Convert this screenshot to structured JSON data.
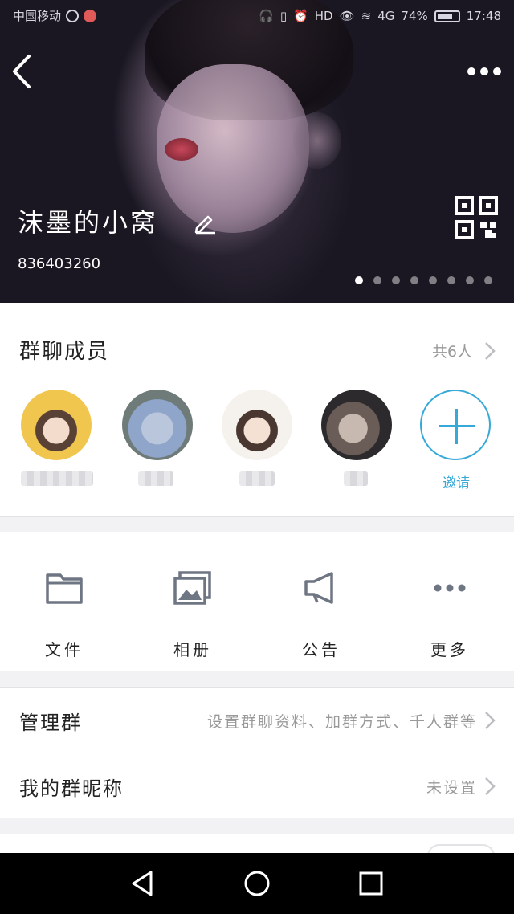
{
  "status_bar": {
    "carrier": "中国移动",
    "network": "4G",
    "battery": "74%",
    "battery_level": 0.74,
    "time": "17:48"
  },
  "header": {
    "group_name": "沫墨的小窝",
    "group_id": "836403260",
    "page_count": 8,
    "page_active": 1
  },
  "members": {
    "title": "群聊成员",
    "count": "共6人",
    "invite_label": "邀请"
  },
  "features": [
    {
      "label": "文件",
      "icon": "folder-icon"
    },
    {
      "label": "相册",
      "icon": "album-icon"
    },
    {
      "label": "公告",
      "icon": "megaphone-icon"
    },
    {
      "label": "更多",
      "icon": "more-dots-icon"
    }
  ],
  "rows": {
    "manage": {
      "label": "管理群",
      "value": "设置群聊资料、加群方式、千人群等"
    },
    "nickname": {
      "label": "我的群昵称",
      "value": "未设置"
    }
  },
  "colors": {
    "accent": "#36a9d9"
  }
}
